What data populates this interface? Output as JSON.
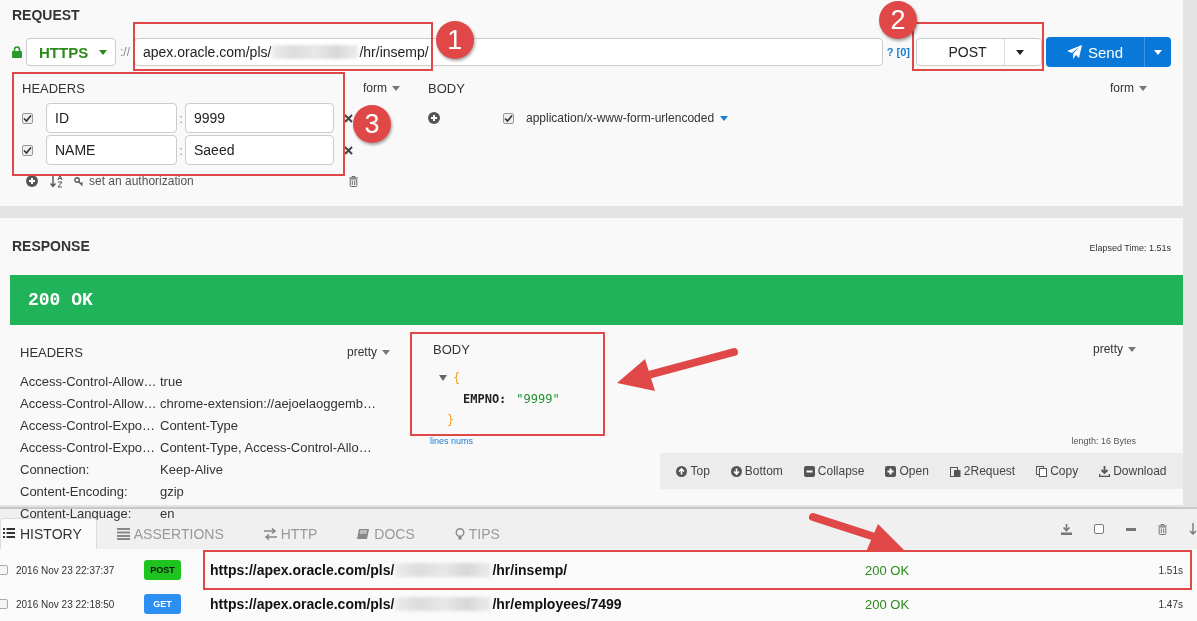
{
  "request": {
    "title": "REQUEST",
    "secure": true,
    "scheme": "HTTPS",
    "separator": "://",
    "url": {
      "prefix": "apex.oracle.com/pls/",
      "redacted": true,
      "suffix": "/hr/insemp/",
      "highlight_box": true,
      "callout": "1"
    },
    "help": "?",
    "param_count": "[0]",
    "method": {
      "value": "POST",
      "highlight_box": true,
      "callout": "2"
    },
    "send_label": "Send",
    "headers": {
      "title": "HEADERS",
      "mode": "form",
      "highlight_box": true,
      "callout": "3",
      "pair_separator": ":",
      "rows": [
        {
          "enabled": true,
          "name": "ID",
          "value": "9999"
        },
        {
          "enabled": true,
          "name": "NAME",
          "value": "Saeed"
        }
      ],
      "auth_link": "set an authorization"
    },
    "body": {
      "title": "BODY",
      "mode": "form",
      "content_type": {
        "enabled": true,
        "label": "application/x-www-form-urlencoded"
      }
    }
  },
  "response": {
    "title": "RESPONSE",
    "elapsed": "Elapsed Time: 1.51s",
    "status": "200 OK",
    "success": true,
    "headers": {
      "title": "HEADERS",
      "mode": "pretty",
      "rows": [
        {
          "name": "Access-Control-Allow…",
          "value": "true"
        },
        {
          "name": "Access-Control-Allow…",
          "value": "chrome-extension://aejoelaoggemb…"
        },
        {
          "name": "Access-Control-Expo…",
          "value": "Content-Type"
        },
        {
          "name": "Access-Control-Expo…",
          "value": "Content-Type, Access-Control-Allo…"
        },
        {
          "name": "Connection:",
          "value": "Keep-Alive"
        },
        {
          "name": "Content-Encoding:",
          "value": "gzip"
        },
        {
          "name": "Content-Language:",
          "value": "en"
        }
      ]
    },
    "body": {
      "title": "BODY",
      "mode": "pretty",
      "expanded": true,
      "open_brace": "{",
      "close_brace": "}",
      "fields": [
        {
          "key": "EMPNO:",
          "value": "\"9999\""
        }
      ],
      "highlight_box": true,
      "arrow": true,
      "line_numbers_link": "lines nums",
      "length": "length: 16 Bytes"
    },
    "toolbar": [
      "Top",
      "Bottom",
      "Collapse",
      "Open",
      "2Request",
      "Copy",
      "Download"
    ]
  },
  "bottom": {
    "tabs": [
      {
        "label": "HISTORY",
        "selected": true
      },
      {
        "label": "ASSERTIONS",
        "selected": false
      },
      {
        "label": "HTTP",
        "selected": false
      },
      {
        "label": "DOCS",
        "selected": false
      },
      {
        "label": "TIPS",
        "selected": false
      }
    ],
    "history": [
      {
        "checked": false,
        "time": "2016 Nov 23 22:37:37",
        "method": "POST",
        "color": "#1ec31e",
        "url_prefix": "https://apex.oracle.com/pls/",
        "redacted": true,
        "url_suffix": "/hr/insemp/",
        "status": "200 OK",
        "duration": "1.51s",
        "highlight_box": true,
        "arrow": true
      },
      {
        "checked": false,
        "time": "2016 Nov 23 22:18:50",
        "method": "GET",
        "color": "#2b8ef0",
        "url_prefix": "https://apex.oracle.com/pls/",
        "redacted": true,
        "url_suffix": "/hr/employees/7499",
        "status": "200 OK",
        "duration": "1.47s",
        "highlight_box": false,
        "arrow": false
      }
    ]
  }
}
